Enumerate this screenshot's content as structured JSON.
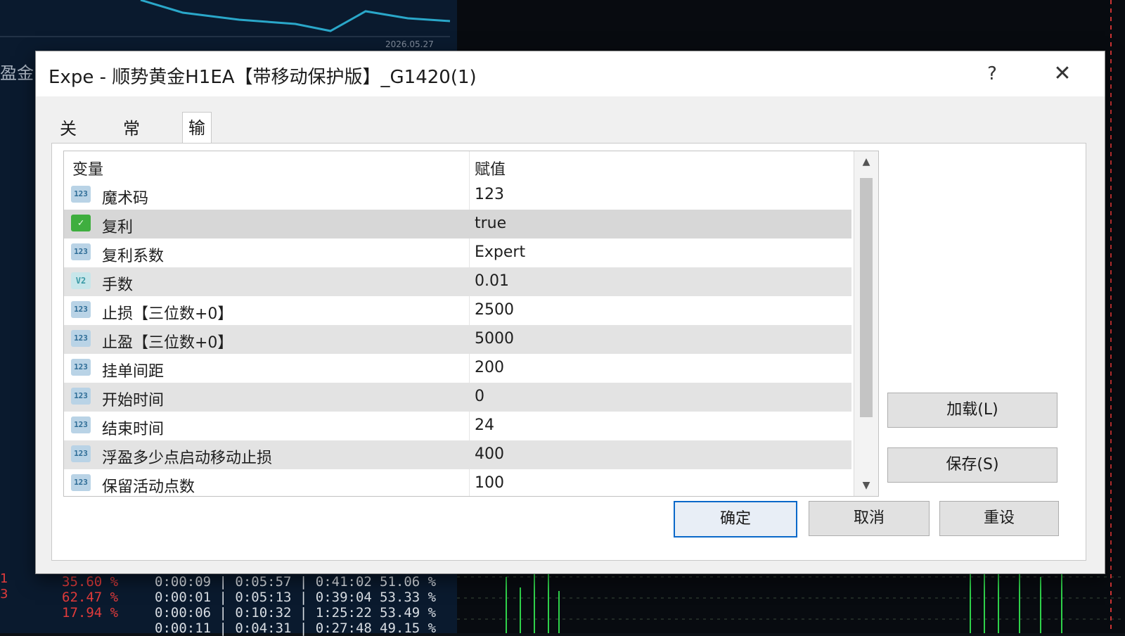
{
  "background": {
    "side_label": "盈金",
    "date_label": "2026.05.27",
    "stats_rows": [
      {
        "red": "35.60 %",
        "times": "0:00:09 | 0:05:57 | 0:41:02",
        "pct": "51.06 %"
      },
      {
        "red": "62.47 %",
        "times": "0:00:01 | 0:05:13 | 0:39:04",
        "pct": "53.33 %"
      },
      {
        "red": "17.94 %",
        "times": "0:00:06 | 0:10:32 | 1:25:22",
        "pct": "53.49 %"
      },
      {
        "red": "",
        "times": "0:00:11 | 0:04:31 | 0:27:48",
        "pct": "49.15 %"
      }
    ],
    "red_marks": [
      "1",
      "3"
    ]
  },
  "dialog": {
    "title": "Expe    - 顺势黄金H1EA【带移动保护版】_G1420(1)",
    "help_label": "?",
    "close_label": "✕"
  },
  "tabs": [
    {
      "label": "关于"
    },
    {
      "label": "常用"
    },
    {
      "label": "输入参数"
    }
  ],
  "table": {
    "col_variable": "变量",
    "col_value": "赋值",
    "rows": [
      {
        "icon": "123",
        "name": "魔术码",
        "value": "123"
      },
      {
        "icon": "✓",
        "name": "复利",
        "value": "true"
      },
      {
        "icon": "123",
        "name": "复利系数",
        "value": "Expert"
      },
      {
        "icon": "V2",
        "name": "手数",
        "value": "0.01"
      },
      {
        "icon": "123",
        "name": "止损【三位数+0】",
        "value": "2500"
      },
      {
        "icon": "123",
        "name": "止盈【三位数+0】",
        "value": "5000"
      },
      {
        "icon": "123",
        "name": "挂单间距",
        "value": "200"
      },
      {
        "icon": "123",
        "name": "开始时间",
        "value": "0"
      },
      {
        "icon": "123",
        "name": "结束时间",
        "value": "24"
      },
      {
        "icon": "123",
        "name": "浮盈多少点启动移动止损",
        "value": "400"
      },
      {
        "icon": "123",
        "name": "保留活动点数",
        "value": "100"
      }
    ]
  },
  "buttons": {
    "load": "加载(L)",
    "save": "保存(S)",
    "ok": "确定",
    "cancel": "取消",
    "reset": "重设"
  },
  "scrollbar": {
    "up": "▲",
    "down": "▼"
  }
}
